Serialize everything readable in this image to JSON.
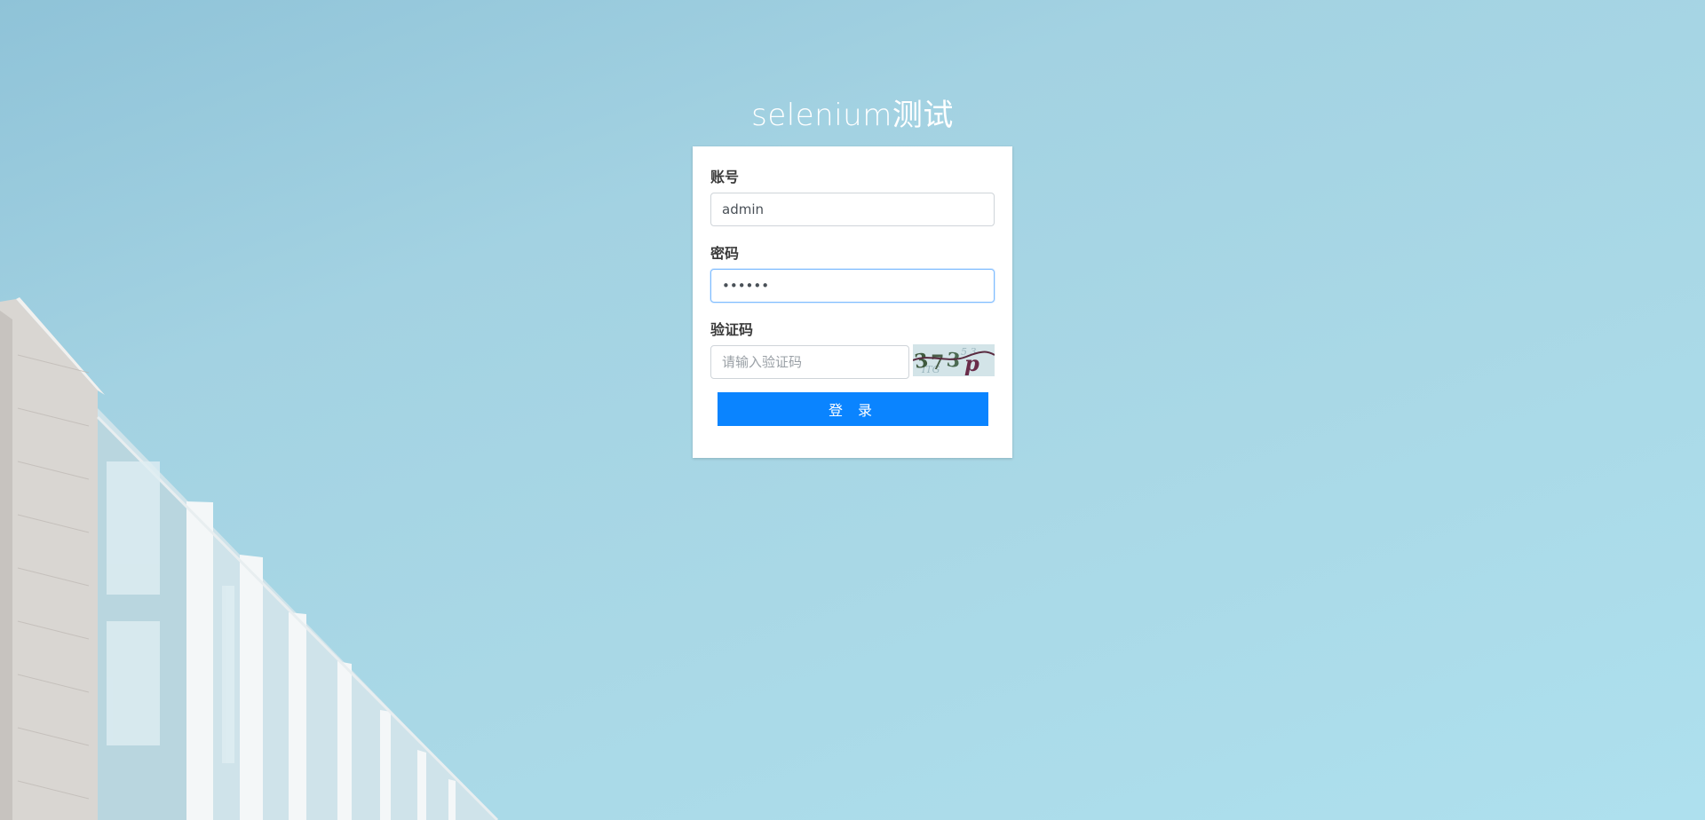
{
  "page": {
    "title": "selenium测试"
  },
  "form": {
    "account_label": "账号",
    "account_value": "admin",
    "password_label": "密码",
    "password_value": "••••••",
    "captcha_label": "验证码",
    "captcha_placeholder": "请输入验证码",
    "captcha_image_text": "373p",
    "login_button": "登 录"
  },
  "colors": {
    "primary": "#0a84ff",
    "background": "#a9d8e6"
  }
}
